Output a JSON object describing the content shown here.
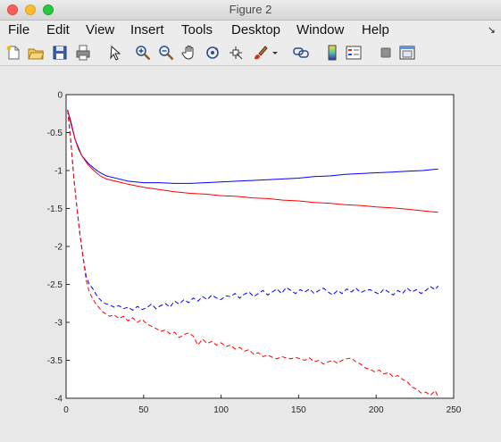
{
  "window": {
    "title": "Figure 2"
  },
  "menu": {
    "items": [
      "File",
      "Edit",
      "View",
      "Insert",
      "Tools",
      "Desktop",
      "Window",
      "Help"
    ],
    "corner_icon": "dock-arrow-icon"
  },
  "toolbar": {
    "icons": [
      "new-figure-icon",
      "open-file-icon",
      "save-icon",
      "print-icon",
      "edit-plot-arrow-icon",
      "zoom-in-icon",
      "zoom-out-icon",
      "pan-hand-icon",
      "rotate-3d-icon",
      "data-cursor-icon",
      "brush-icon",
      "brush-dropdown-icon",
      "link-plot-icon",
      "colorbar-icon",
      "legend-icon",
      "hide-plot-tools-icon",
      "show-plot-tools-icon"
    ]
  },
  "chart_data": {
    "type": "line",
    "title": "",
    "xlabel": "",
    "ylabel": "",
    "xlim": [
      0,
      250
    ],
    "ylim": [
      -4,
      0
    ],
    "xticks": [
      "0",
      "50",
      "100",
      "150",
      "200",
      "250"
    ],
    "yticks": [
      "0",
      "-0.5",
      "-1",
      "-1.5",
      "-2",
      "-2.5",
      "-3",
      "-3.5",
      "-4"
    ],
    "grid": false,
    "series": [
      {
        "color": "#0000ff",
        "style": "solid",
        "x": [
          1,
          3,
          6,
          8,
          10,
          14,
          18,
          22,
          26,
          30,
          36,
          40,
          45,
          50,
          60,
          70,
          80,
          90,
          100,
          110,
          120,
          130,
          140,
          150,
          160,
          170,
          180,
          190,
          200,
          210,
          220,
          230,
          240
        ],
        "y": [
          -0.2,
          -0.35,
          -0.6,
          -0.7,
          -0.8,
          -0.9,
          -0.97,
          -1.03,
          -1.07,
          -1.09,
          -1.12,
          -1.14,
          -1.15,
          -1.16,
          -1.16,
          -1.17,
          -1.17,
          -1.16,
          -1.15,
          -1.14,
          -1.13,
          -1.12,
          -1.11,
          -1.1,
          -1.08,
          -1.07,
          -1.05,
          -1.04,
          -1.03,
          -1.02,
          -1.01,
          -1.0,
          -0.98
        ]
      },
      {
        "color": "#ff0000",
        "style": "solid",
        "x": [
          1,
          3,
          6,
          8,
          10,
          14,
          18,
          22,
          26,
          30,
          36,
          40,
          45,
          50,
          60,
          70,
          80,
          90,
          100,
          110,
          120,
          130,
          140,
          150,
          160,
          170,
          180,
          190,
          200,
          210,
          220,
          230,
          240
        ],
        "y": [
          -0.2,
          -0.38,
          -0.6,
          -0.72,
          -0.8,
          -0.92,
          -1.0,
          -1.07,
          -1.11,
          -1.13,
          -1.16,
          -1.18,
          -1.2,
          -1.22,
          -1.25,
          -1.28,
          -1.3,
          -1.31,
          -1.33,
          -1.34,
          -1.36,
          -1.37,
          -1.39,
          -1.4,
          -1.42,
          -1.43,
          -1.45,
          -1.46,
          -1.48,
          -1.49,
          -1.51,
          -1.53,
          -1.55
        ]
      },
      {
        "color": "#0000ff",
        "style": "dashed",
        "x": [
          1,
          3,
          5,
          7,
          9,
          11,
          13,
          15,
          17,
          19,
          21,
          23,
          25,
          28,
          31,
          34,
          37,
          40,
          43,
          46,
          49,
          52,
          55,
          58,
          61,
          64,
          67,
          70,
          73,
          76,
          79,
          82,
          85,
          88,
          91,
          94,
          97,
          100,
          103,
          106,
          109,
          112,
          115,
          118,
          121,
          124,
          127,
          130,
          133,
          136,
          139,
          142,
          145,
          148,
          151,
          154,
          157,
          160,
          163,
          166,
          169,
          172,
          175,
          178,
          181,
          184,
          187,
          190,
          193,
          196,
          199,
          202,
          205,
          208,
          211,
          214,
          217,
          220,
          223,
          226,
          229,
          232,
          235,
          238,
          240
        ],
        "y": [
          -0.2,
          -0.6,
          -1.1,
          -1.5,
          -1.85,
          -2.15,
          -2.4,
          -2.5,
          -2.55,
          -2.62,
          -2.68,
          -2.72,
          -2.75,
          -2.77,
          -2.8,
          -2.78,
          -2.82,
          -2.8,
          -2.84,
          -2.79,
          -2.83,
          -2.81,
          -2.76,
          -2.82,
          -2.78,
          -2.75,
          -2.8,
          -2.72,
          -2.76,
          -2.7,
          -2.74,
          -2.68,
          -2.72,
          -2.66,
          -2.7,
          -2.64,
          -2.68,
          -2.7,
          -2.65,
          -2.66,
          -2.62,
          -2.68,
          -2.63,
          -2.6,
          -2.66,
          -2.62,
          -2.58,
          -2.64,
          -2.6,
          -2.56,
          -2.62,
          -2.54,
          -2.58,
          -2.62,
          -2.57,
          -2.6,
          -2.56,
          -2.62,
          -2.58,
          -2.55,
          -2.6,
          -2.64,
          -2.58,
          -2.62,
          -2.56,
          -2.6,
          -2.55,
          -2.61,
          -2.58,
          -2.57,
          -2.6,
          -2.63,
          -2.56,
          -2.6,
          -2.64,
          -2.58,
          -2.62,
          -2.55,
          -2.6,
          -2.57,
          -2.62,
          -2.58,
          -2.53,
          -2.57,
          -2.52
        ]
      },
      {
        "color": "#ff0000",
        "style": "dashed",
        "x": [
          1,
          3,
          5,
          7,
          9,
          11,
          13,
          15,
          17,
          19,
          21,
          23,
          25,
          28,
          31,
          34,
          37,
          40,
          43,
          46,
          49,
          52,
          55,
          58,
          61,
          64,
          67,
          70,
          73,
          76,
          79,
          82,
          85,
          88,
          91,
          94,
          97,
          100,
          103,
          106,
          109,
          112,
          115,
          118,
          121,
          124,
          127,
          130,
          133,
          136,
          139,
          142,
          145,
          148,
          151,
          154,
          157,
          160,
          163,
          166,
          169,
          172,
          175,
          178,
          181,
          184,
          187,
          190,
          193,
          196,
          199,
          202,
          205,
          208,
          211,
          214,
          217,
          220,
          223,
          226,
          229,
          232,
          235,
          238,
          240
        ],
        "y": [
          -0.2,
          -0.6,
          -1.1,
          -1.5,
          -1.85,
          -2.15,
          -2.45,
          -2.6,
          -2.68,
          -2.75,
          -2.8,
          -2.85,
          -2.88,
          -2.92,
          -2.9,
          -2.95,
          -2.92,
          -2.98,
          -2.94,
          -3.0,
          -2.96,
          -3.02,
          -3.05,
          -3.08,
          -3.12,
          -3.1,
          -3.15,
          -3.13,
          -3.2,
          -3.16,
          -3.14,
          -3.18,
          -3.3,
          -3.22,
          -3.28,
          -3.25,
          -3.3,
          -3.27,
          -3.32,
          -3.3,
          -3.35,
          -3.33,
          -3.38,
          -3.36,
          -3.42,
          -3.4,
          -3.45,
          -3.43,
          -3.46,
          -3.48,
          -3.45,
          -3.47,
          -3.48,
          -3.46,
          -3.48,
          -3.5,
          -3.47,
          -3.52,
          -3.5,
          -3.55,
          -3.52,
          -3.5,
          -3.54,
          -3.5,
          -3.48,
          -3.47,
          -3.52,
          -3.55,
          -3.6,
          -3.62,
          -3.65,
          -3.63,
          -3.68,
          -3.66,
          -3.72,
          -3.7,
          -3.75,
          -3.78,
          -3.85,
          -3.88,
          -3.93,
          -3.92,
          -3.96,
          -3.9,
          -3.98
        ]
      }
    ]
  }
}
